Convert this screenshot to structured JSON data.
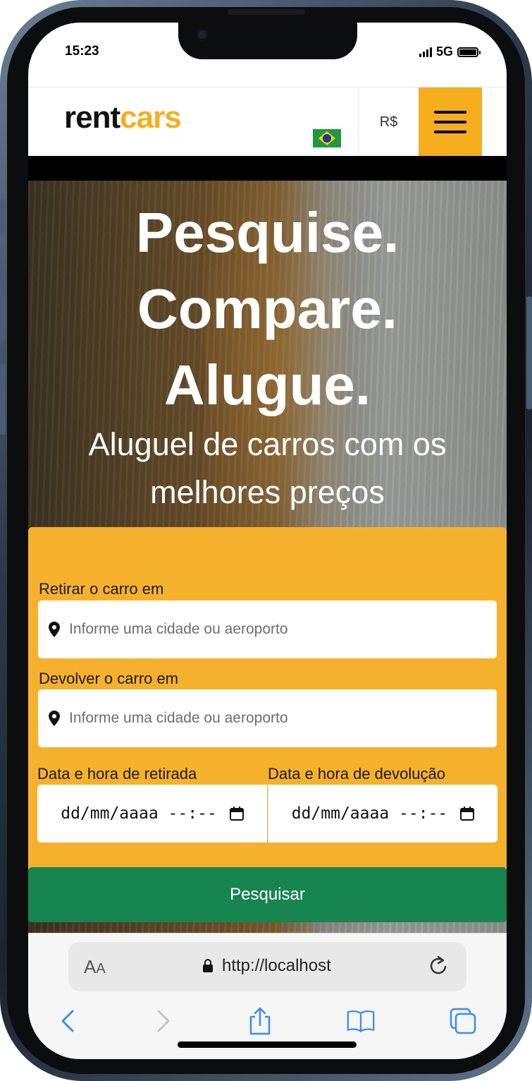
{
  "status_bar": {
    "time": "15:23",
    "network": "5G"
  },
  "header": {
    "logo_part1": "rent",
    "logo_part2": "cars",
    "currency": "R$",
    "accent_color": "#f6ad1e"
  },
  "hero": {
    "title_line1": "Pesquise.",
    "title_line2": "Compare.",
    "title_line3": "Alugue.",
    "subtitle": "Aluguel de carros com os melhores preços"
  },
  "search": {
    "pickup_label": "Retirar o carro em",
    "pickup_placeholder": "Informe uma cidade ou aeroporto",
    "dropoff_label": "Devolver o carro em",
    "dropoff_placeholder": "Informe uma cidade ou aeroporto",
    "pickup_datetime_label": "Data e hora de retirada",
    "pickup_datetime_value": "dd/mm/aaaa --:--",
    "dropoff_datetime_label": "Data e hora de devolução",
    "dropoff_datetime_value": "dd/mm/aaaa --:--",
    "submit_label": "Pesquisar",
    "panel_color": "#f6b12c",
    "button_color": "#178550"
  },
  "browser": {
    "text_size_label": "A",
    "text_size_label_small": "A",
    "url": "http://localhost"
  }
}
